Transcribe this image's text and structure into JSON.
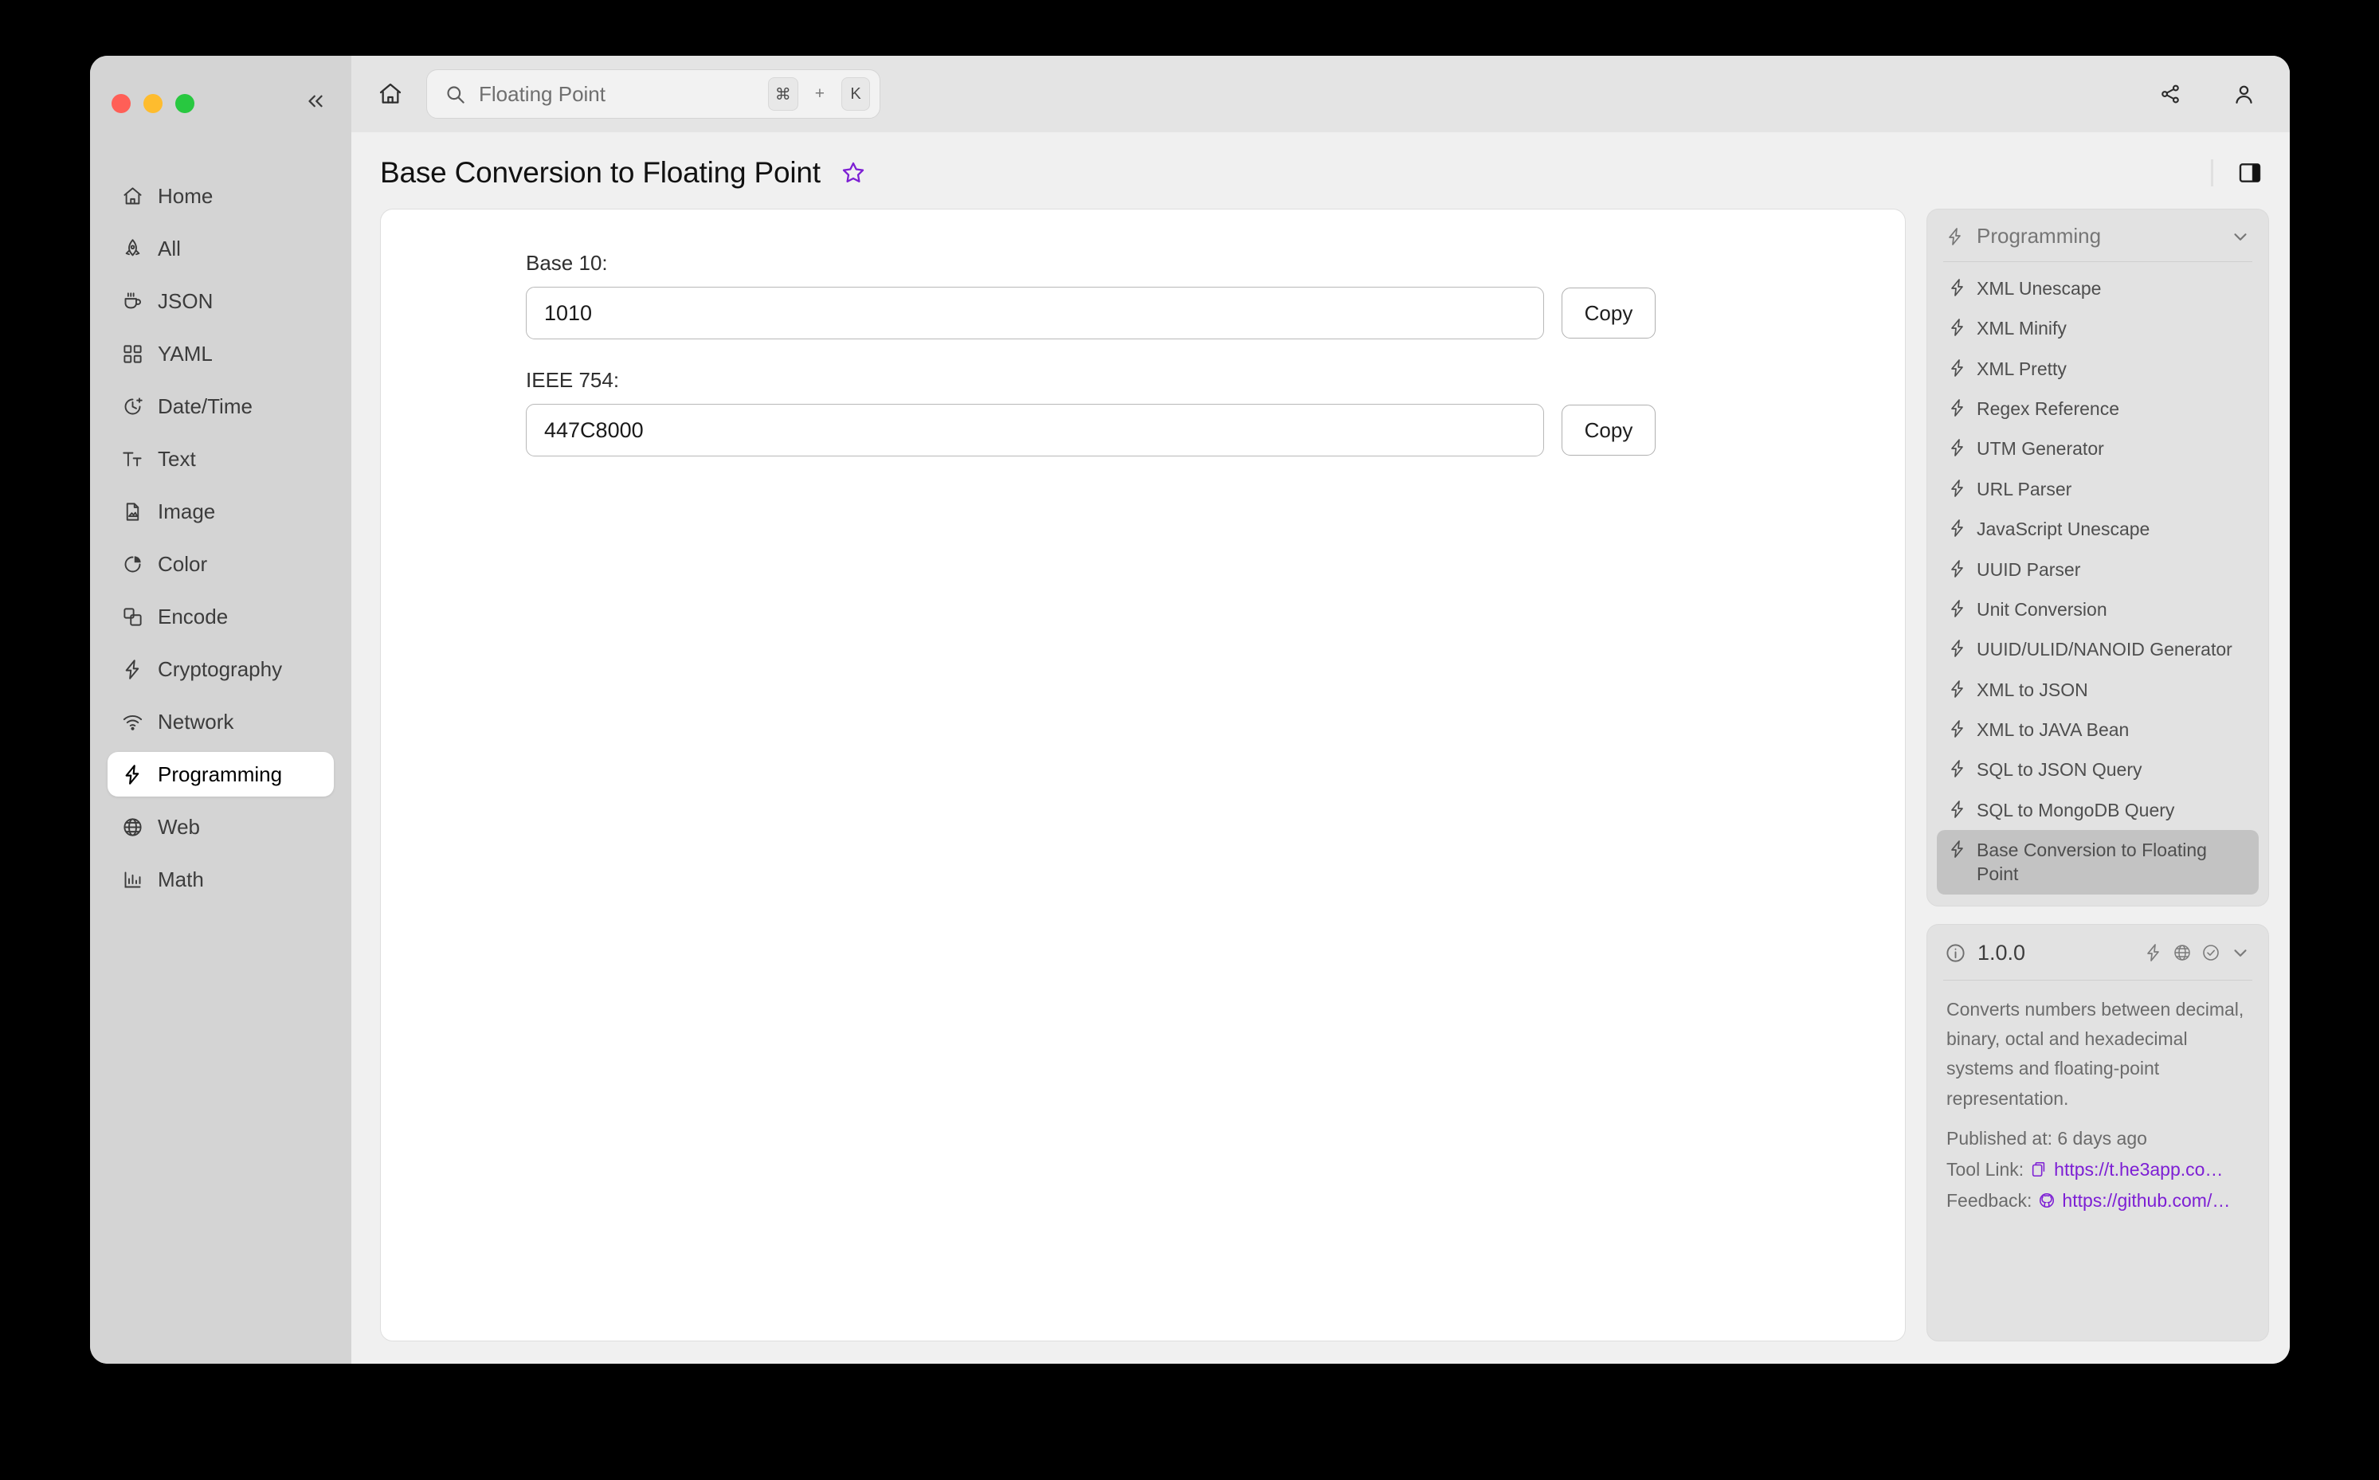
{
  "window": {
    "traffic_lights": [
      "close",
      "minimize",
      "maximize"
    ],
    "collapse_icon": "chevrons-left-icon"
  },
  "sidebar": {
    "items": [
      {
        "label": "Home",
        "icon": "home-icon",
        "active": false
      },
      {
        "label": "All",
        "icon": "rocket-icon",
        "active": false
      },
      {
        "label": "JSON",
        "icon": "coffee-cup-icon",
        "active": false
      },
      {
        "label": "YAML",
        "icon": "grid-icon",
        "active": false
      },
      {
        "label": "Date/Time",
        "icon": "clock-icon",
        "active": false
      },
      {
        "label": "Text",
        "icon": "text-size-icon",
        "active": false
      },
      {
        "label": "Image",
        "icon": "image-file-icon",
        "active": false
      },
      {
        "label": "Color",
        "icon": "pie-chart-icon",
        "active": false
      },
      {
        "label": "Encode",
        "icon": "layers-icon",
        "active": false
      },
      {
        "label": "Cryptography",
        "icon": "lightning-icon",
        "active": false
      },
      {
        "label": "Network",
        "icon": "wifi-icon",
        "active": false
      },
      {
        "label": "Programming",
        "icon": "lightning-icon",
        "active": true
      },
      {
        "label": "Web",
        "icon": "globe-icon",
        "active": false
      },
      {
        "label": "Math",
        "icon": "bar-chart-icon",
        "active": false
      }
    ]
  },
  "topbar": {
    "home_icon": "home-icon",
    "search": {
      "value": "Floating Point",
      "placeholder": "Floating Point",
      "icon": "search-icon",
      "shortcut_key": "⌘",
      "shortcut_plus": "+",
      "shortcut_letter": "K"
    },
    "share_icon": "share-icon",
    "account_icon": "user-icon"
  },
  "page": {
    "title": "Base Conversion to Floating Point",
    "favorite_icon": "star-outline-icon",
    "favorite_color": "#7d1fd4",
    "panel_toggle_icon": "sidebar-toggle-icon"
  },
  "form": {
    "fields": [
      {
        "label": "Base 10:",
        "value": "1010",
        "copy_label": "Copy"
      },
      {
        "label": "IEEE 754:",
        "value": "447C8000",
        "copy_label": "Copy"
      }
    ]
  },
  "right_panel": {
    "category": {
      "title": "Programming",
      "icon": "lightning-icon",
      "chevron_icon": "chevron-down-icon"
    },
    "tools": [
      {
        "label": "XML Unescape",
        "selected": false
      },
      {
        "label": "XML Minify",
        "selected": false
      },
      {
        "label": "XML Pretty",
        "selected": false
      },
      {
        "label": "Regex Reference",
        "selected": false
      },
      {
        "label": "UTM Generator",
        "selected": false
      },
      {
        "label": "URL Parser",
        "selected": false
      },
      {
        "label": "JavaScript Unescape",
        "selected": false
      },
      {
        "label": "UUID Parser",
        "selected": false
      },
      {
        "label": "Unit Conversion",
        "selected": false
      },
      {
        "label": "UUID/ULID/NANOID Generator",
        "selected": false
      },
      {
        "label": "XML to JSON",
        "selected": false
      },
      {
        "label": "XML to JAVA Bean",
        "selected": false
      },
      {
        "label": "SQL to JSON Query",
        "selected": false
      },
      {
        "label": "SQL to MongoDB Query",
        "selected": false
      },
      {
        "label": "Base Conversion to Floating Point",
        "selected": true
      }
    ],
    "info": {
      "info_icon": "info-circle-icon",
      "version": "1.0.0",
      "badges": [
        "lightning-icon",
        "globe-icon",
        "check-circle-icon"
      ],
      "chevron_icon": "chevron-down-icon",
      "description": "Converts numbers between decimal, binary, octal and hexadecimal systems and floating-point representation.",
      "published_label": "Published at: 6 days ago",
      "tool_link_label": "Tool Link:",
      "tool_link_icon": "external-copy-icon",
      "tool_link_url": "https://t.he3app.co…",
      "feedback_label": "Feedback:",
      "feedback_icon": "github-icon",
      "feedback_url": "https://github.com/…",
      "link_color": "#7d1fd4"
    }
  }
}
